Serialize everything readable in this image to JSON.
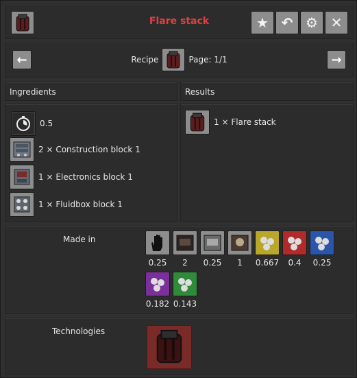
{
  "window": {
    "title": "Flare stack",
    "title_color": "#e0413d",
    "icon": "flare-stack-icon",
    "toolbar": [
      {
        "icon": "star-icon",
        "glyph": "★"
      },
      {
        "icon": "back-arrow-icon",
        "glyph": "↶"
      },
      {
        "icon": "gear-icon",
        "glyph": "⚙"
      },
      {
        "icon": "close-icon",
        "glyph": "✕"
      }
    ]
  },
  "nav": {
    "prev_glyph": "←",
    "next_glyph": "→",
    "recipe_label": "Recipe",
    "page_label": "Page: 1/1"
  },
  "ingredients": {
    "header": "Ingredients",
    "items": [
      {
        "icon": "time-icon",
        "text": "0.5"
      },
      {
        "icon": "construction-block-icon",
        "text": "2 × Construction block 1"
      },
      {
        "icon": "electronics-block-icon",
        "text": "1 × Electronics block 1"
      },
      {
        "icon": "fluidbox-block-icon",
        "text": "1 × Fluidbox block 1"
      }
    ]
  },
  "results": {
    "header": "Results",
    "items": [
      {
        "icon": "flare-stack-icon",
        "text": "1 × Flare stack"
      }
    ]
  },
  "made_in": {
    "label": "Made in",
    "machines": [
      {
        "icon": "hand-icon",
        "value": "0.25",
        "color": "#8d8d8d"
      },
      {
        "icon": "assembler-dark-icon",
        "value": "2",
        "color": "#8d8d8d"
      },
      {
        "icon": "assembler-grey-icon",
        "value": "0.25",
        "color": "#8d8d8d"
      },
      {
        "icon": "assembler-brown-icon",
        "value": "1",
        "color": "#8d8d8d"
      },
      {
        "icon": "assembler-yellow-icon",
        "value": "0.667",
        "color": "#b9a72a"
      },
      {
        "icon": "assembler-red-icon",
        "value": "0.4",
        "color": "#b02a2a"
      },
      {
        "icon": "assembler-blue-icon",
        "value": "0.25",
        "color": "#2b55a8"
      },
      {
        "icon": "assembler-purple-icon",
        "value": "0.182",
        "color": "#7a2f9a"
      },
      {
        "icon": "assembler-green-icon",
        "value": "0.143",
        "color": "#2f8a3a"
      }
    ]
  },
  "technologies": {
    "label": "Technologies",
    "icon": "flare-stack-technology-icon"
  }
}
